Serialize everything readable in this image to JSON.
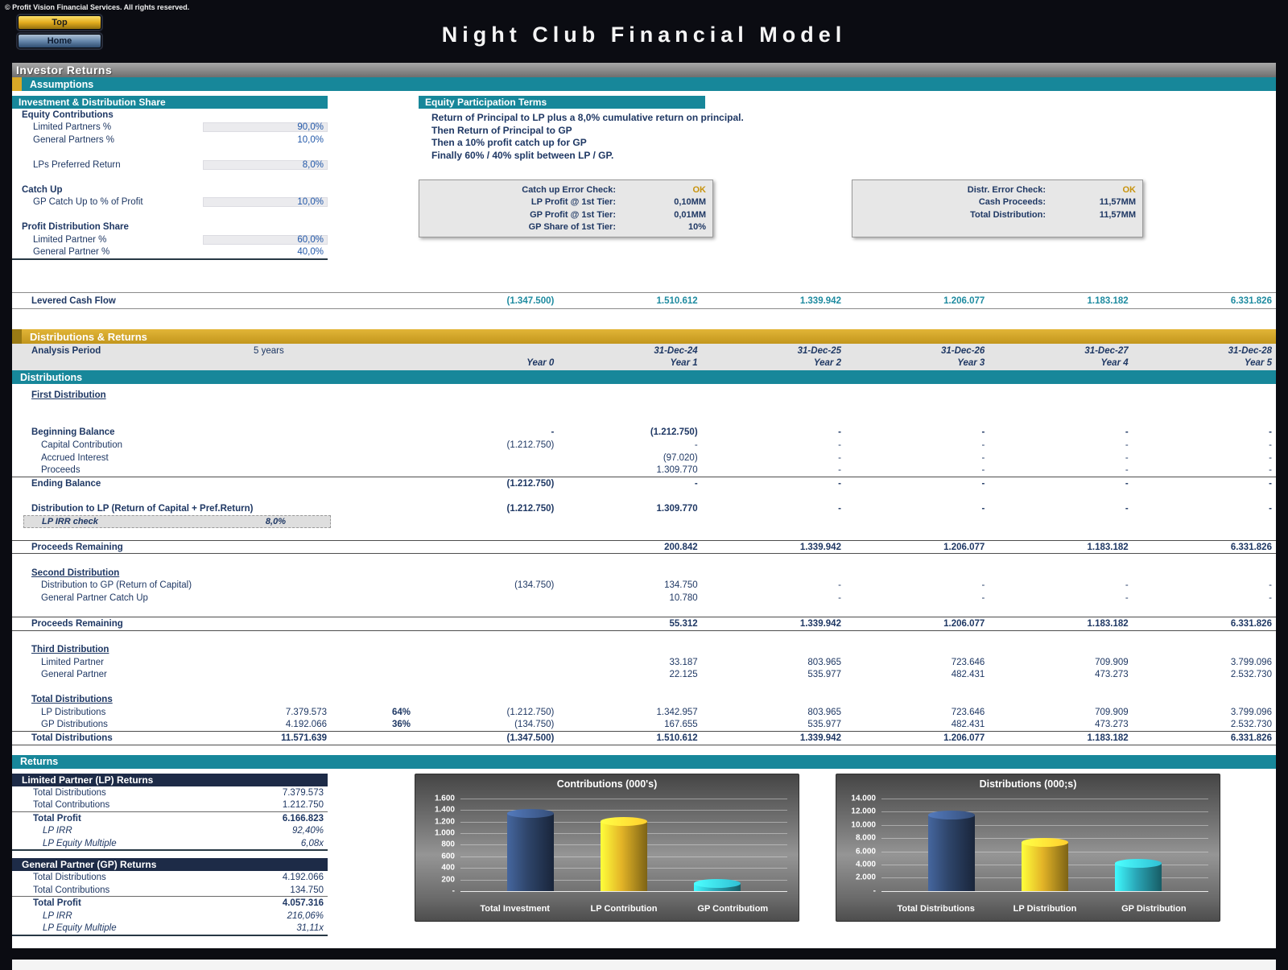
{
  "page": {
    "copyright": "© Profit Vision Financial Services. All rights reserved.",
    "title": "Night Club Financial Model",
    "nav": {
      "top_label": "Top",
      "home_label": "Home"
    }
  },
  "section_bars": {
    "investor_returns": "Investor Returns",
    "assumptions": "Assumptions",
    "distributions_returns": "Distributions & Returns",
    "distributions": "Distributions",
    "returns": "Returns"
  },
  "assumptions_panel": {
    "header": "Investment & Distribution Share",
    "rows": [
      {
        "type": "group",
        "label": "Equity Contributions"
      },
      {
        "type": "input",
        "label": "Limited Partners %",
        "value": "90,0%"
      },
      {
        "type": "calc",
        "label": "General Partners %",
        "value": "10,0%"
      },
      {
        "type": "spacer"
      },
      {
        "type": "input",
        "label": "LPs Preferred Return",
        "value": "8,0%"
      },
      {
        "type": "spacer"
      },
      {
        "type": "group",
        "label": "Catch Up"
      },
      {
        "type": "input",
        "label": "GP Catch Up to % of Profit",
        "value": "10,0%"
      },
      {
        "type": "spacer"
      },
      {
        "type": "group",
        "label": "Profit Distribution Share"
      },
      {
        "type": "input",
        "label": "Limited Partner %",
        "value": "60,0%"
      },
      {
        "type": "calc",
        "label": "General Partner %",
        "value": "40,0%"
      }
    ]
  },
  "equity_terms": {
    "header": "Equity Participation Terms",
    "lines": [
      "Return of Principal to LP plus a 8,0% cumulative return on principal.",
      "Then Return of Principal to GP",
      "Then a 10% profit catch up for GP",
      "Finally 60% / 40% split between LP / GP."
    ]
  },
  "checks": [
    {
      "title": "Catch up Error Check:",
      "status": "OK",
      "rows": [
        {
          "label": "LP Profit @ 1st Tier:",
          "value": "0,10MM"
        },
        {
          "label": "GP Profit @ 1st Tier:",
          "value": "0,01MM"
        },
        {
          "label": "GP Share of 1st Tier:",
          "value": "10%"
        }
      ]
    },
    {
      "title": "Distr. Error Check:",
      "status": "OK",
      "rows": [
        {
          "label": "Cash Proceeds:",
          "value": "11,57MM"
        },
        {
          "label": "Total Distribution:",
          "value": "11,57MM"
        }
      ]
    }
  ],
  "levered_cash_flow": {
    "label": "Levered Cash Flow",
    "values": [
      "(1.347.500)",
      "1.510.612",
      "1.339.942",
      "1.206.077",
      "1.183.182",
      "6.331.826"
    ]
  },
  "analysis": {
    "label": "Analysis Period",
    "value": "5 years",
    "dates": [
      "",
      "31-Dec-24",
      "31-Dec-25",
      "31-Dec-26",
      "31-Dec-27",
      "31-Dec-28"
    ],
    "years": [
      "Year 0",
      "Year 1",
      "Year 2",
      "Year 3",
      "Year 4",
      "Year 5"
    ]
  },
  "distribution_rows": [
    {
      "type": "sub",
      "label": "First Distribution"
    },
    {
      "type": "spacer"
    },
    {
      "type": "spacer"
    },
    {
      "type": "row",
      "style": "bold",
      "label": "Beginning Balance",
      "cells": [
        "-",
        "(1.212.750)",
        "-",
        "-",
        "-",
        "-"
      ]
    },
    {
      "type": "row",
      "style": "indent",
      "label": "Capital Contribution",
      "cells": [
        "(1.212.750)",
        "-",
        "-",
        "-",
        "-",
        "-"
      ]
    },
    {
      "type": "row",
      "style": "indent",
      "label": "Accrued Interest",
      "cells": [
        "",
        "(97.020)",
        "-",
        "-",
        "-",
        "-"
      ]
    },
    {
      "type": "row",
      "style": "indent",
      "label": "Proceeds",
      "cells": [
        "",
        "1.309.770",
        "-",
        "-",
        "-",
        "-"
      ]
    },
    {
      "type": "row",
      "style": "bold bt",
      "label": "Ending Balance",
      "cells": [
        "(1.212.750)",
        "-",
        "-",
        "-",
        "-",
        "-"
      ]
    },
    {
      "type": "spacer"
    },
    {
      "type": "row",
      "style": "bold",
      "label": "Distribution to LP (Return of Capital + Pref.Return)",
      "cells": [
        "(1.212.750)",
        "1.309.770",
        "-",
        "-",
        "-",
        "-"
      ]
    },
    {
      "type": "check",
      "label": "LP IRR check",
      "value": "8,0%"
    },
    {
      "type": "spacer"
    },
    {
      "type": "row",
      "style": "bold btb",
      "label": "Proceeds Remaining",
      "cells": [
        "",
        "200.842",
        "1.339.942",
        "1.206.077",
        "1.183.182",
        "6.331.826"
      ]
    },
    {
      "type": "spacer"
    },
    {
      "type": "sub",
      "label": "Second Distribution"
    },
    {
      "type": "row",
      "style": "indent",
      "label": "Distribution to GP (Return of Capital)",
      "cells": [
        "(134.750)",
        "134.750",
        "-",
        "-",
        "-",
        "-"
      ]
    },
    {
      "type": "row",
      "style": "indent",
      "label": "General Partner Catch Up",
      "cells": [
        "",
        "10.780",
        "-",
        "-",
        "-",
        "-"
      ]
    },
    {
      "type": "spacer"
    },
    {
      "type": "row",
      "style": "bold btb",
      "label": "Proceeds Remaining",
      "cells": [
        "",
        "55.312",
        "1.339.942",
        "1.206.077",
        "1.183.182",
        "6.331.826"
      ]
    },
    {
      "type": "spacer"
    },
    {
      "type": "sub",
      "label": "Third Distribution"
    },
    {
      "type": "row",
      "style": "indent",
      "label": "Limited Partner",
      "cells": [
        "",
        "33.187",
        "803.965",
        "723.646",
        "709.909",
        "3.799.096"
      ]
    },
    {
      "type": "row",
      "style": "indent",
      "label": "General Partner",
      "cells": [
        "",
        "22.125",
        "535.977",
        "482.431",
        "473.273",
        "2.532.730"
      ]
    },
    {
      "type": "spacer"
    },
    {
      "type": "sub",
      "label": "Total Distributions"
    },
    {
      "type": "row",
      "style": "indent",
      "label": "LP Distributions",
      "total": "7.379.573",
      "pct": "64%",
      "cells": [
        "(1.212.750)",
        "1.342.957",
        "803.965",
        "723.646",
        "709.909",
        "3.799.096"
      ]
    },
    {
      "type": "row",
      "style": "indent",
      "label": "GP Distributions",
      "total": "4.192.066",
      "pct": "36%",
      "cells": [
        "(134.750)",
        "167.655",
        "535.977",
        "482.431",
        "473.273",
        "2.532.730"
      ]
    },
    {
      "type": "row",
      "style": "bold bt bb",
      "label": "Total Distributions",
      "total": "11.571.639",
      "pct": "",
      "cells": [
        "(1.347.500)",
        "1.510.612",
        "1.339.942",
        "1.206.077",
        "1.183.182",
        "6.331.826"
      ]
    }
  ],
  "returns_tables": [
    {
      "header": "Limited Partner (LP) Returns",
      "rows": [
        {
          "label": "Total Distributions",
          "value": "7.379.573",
          "style": "plain"
        },
        {
          "label": "Total Contributions",
          "value": "1.212.750",
          "style": "plain"
        },
        {
          "label": "Total Profit",
          "value": "6.166.823",
          "style": "bold"
        },
        {
          "label": "LP IRR",
          "value": "92,40%",
          "style": "italic"
        },
        {
          "label": "LP Equity Multiple",
          "value": "6,08x",
          "style": "italic"
        }
      ]
    },
    {
      "header": "General Partner (GP) Returns",
      "rows": [
        {
          "label": "Total Distributions",
          "value": "4.192.066",
          "style": "plain"
        },
        {
          "label": "Total Contributions",
          "value": "134.750",
          "style": "plain"
        },
        {
          "label": "Total Profit",
          "value": "4.057.316",
          "style": "bold"
        },
        {
          "label": "LP IRR",
          "value": "216,06%",
          "style": "italic"
        },
        {
          "label": "LP Equity Multiple",
          "value": "31,11x",
          "style": "italic"
        }
      ]
    }
  ],
  "chart_data": [
    {
      "type": "bar",
      "title": "Contributions (000's)",
      "categories": [
        "Total Investment",
        "LP Contribution",
        "GP Contributiom"
      ],
      "values": [
        1348,
        1213,
        135
      ],
      "xlabel": "",
      "ylabel": "",
      "ylim": [
        0,
        1600
      ],
      "yticks": [
        "-",
        "200",
        "400",
        "600",
        "800",
        "1.000",
        "1.200",
        "1.400",
        "1.600"
      ],
      "bar_colors": [
        "#2e4469",
        "#e3b427",
        "#2aa7b8"
      ],
      "grid": true,
      "legend": "none"
    },
    {
      "type": "bar",
      "title": "Distributions (000;s)",
      "categories": [
        "Total Distributions",
        "LP Distribution",
        "GP Distribution"
      ],
      "values": [
        11572,
        7380,
        4192
      ],
      "xlabel": "",
      "ylabel": "",
      "ylim": [
        0,
        14000
      ],
      "yticks": [
        "-",
        "2.000",
        "4.000",
        "6.000",
        "8.000",
        "10.000",
        "12.000",
        "14.000"
      ],
      "bar_colors": [
        "#2e4469",
        "#e3b427",
        "#2aa7b8"
      ],
      "grid": true,
      "legend": "none"
    }
  ]
}
